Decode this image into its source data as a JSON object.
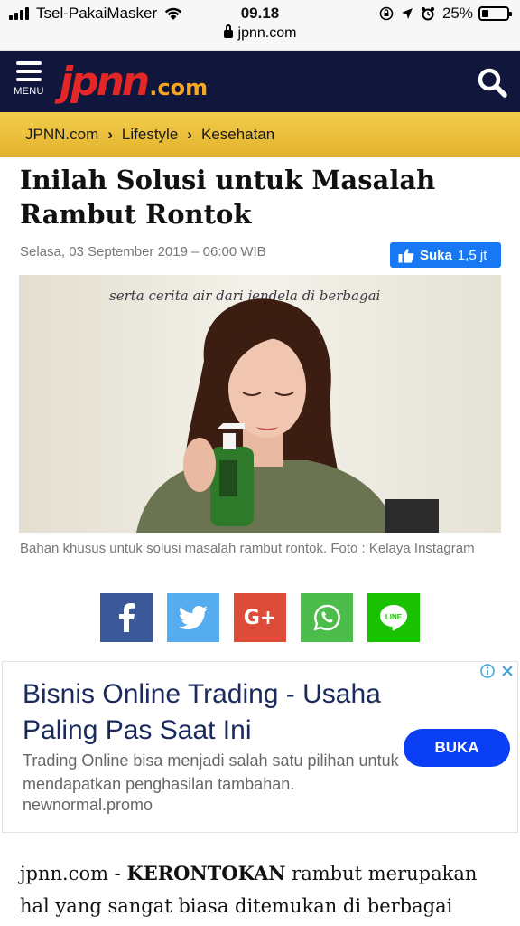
{
  "status_bar": {
    "carrier": "Tsel-PakaiMasker",
    "time": "09.18",
    "battery_percent": "25%",
    "url": "jpnn.com"
  },
  "header": {
    "menu_label": "MENU",
    "logo_main": "jpnn",
    "logo_suffix": ".com",
    "background": "#10163c"
  },
  "breadcrumb": {
    "items": [
      "JPNN.com",
      "Lifestyle",
      "Kesehatan"
    ]
  },
  "article": {
    "title": "Inilah Solusi untuk Masalah Rambut Rontok",
    "date": "Selasa, 03 September 2019 – 06:00 WIB",
    "like": {
      "label": "Suka",
      "count": "1,5 jt"
    },
    "photo_wall_text": "serta cerita air dari jendela di berbagai",
    "caption": "Bahan khusus untuk solusi masalah rambut rontok. Foto : Kelaya Instagram",
    "body_source": "jpnn.com -",
    "body_keyword": "KERONTOKAN",
    "body_rest": "rambut merupakan hal yang sangat biasa ditemukan di berbagai"
  },
  "share": [
    {
      "name": "facebook",
      "color": "#3b5998",
      "icon": "facebook-icon"
    },
    {
      "name": "twitter",
      "color": "#55acee",
      "icon": "twitter-icon"
    },
    {
      "name": "google-plus",
      "color": "#dd4b39",
      "icon": "google-plus-icon"
    },
    {
      "name": "whatsapp",
      "color": "#4cbc4a",
      "icon": "whatsapp-icon"
    },
    {
      "name": "line",
      "color": "#19c100",
      "icon": "line-icon"
    }
  ],
  "ad": {
    "title": "Bisnis Online Trading - Usaha Paling Pas Saat Ini",
    "description": "Trading Online bisa menjadi salah satu pilihan untuk mendapatkan penghasilan tambahan.",
    "domain": "newnormal.promo",
    "cta": "BUKA"
  }
}
